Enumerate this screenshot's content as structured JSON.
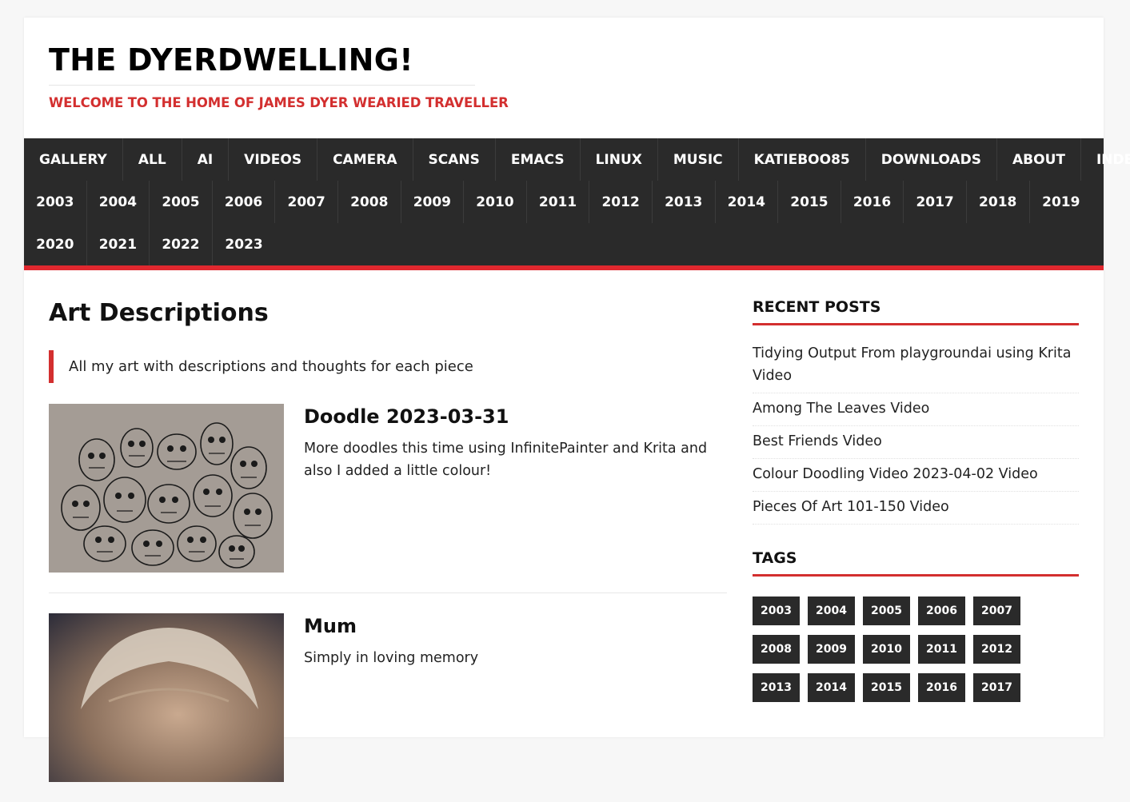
{
  "site": {
    "title": "THE DYERDWELLING!",
    "tagline": "WELCOME TO THE HOME OF JAMES DYER WEARIED TRAVELLER"
  },
  "nav": {
    "row1": [
      "GALLERY",
      "ALL",
      "AI",
      "VIDEOS",
      "CAMERA",
      "SCANS",
      "EMACS",
      "LINUX",
      "MUSIC",
      "KATIEBOO85",
      "DOWNLOADS",
      "ABOUT",
      "INDEX"
    ],
    "row2": [
      "2003",
      "2004",
      "2005",
      "2006",
      "2007",
      "2008",
      "2009",
      "2010",
      "2011",
      "2012",
      "2013",
      "2014",
      "2015",
      "2016",
      "2017",
      "2018",
      "2019"
    ],
    "row3": [
      "2020",
      "2021",
      "2022",
      "2023"
    ]
  },
  "main": {
    "heading": "Art Descriptions",
    "description": "All my art with descriptions and thoughts for each piece",
    "posts": [
      {
        "title": "Doodle 2023-03-31",
        "excerpt": "More doodles this time using InfinitePainter and Krita and also I added a little colour!"
      },
      {
        "title": "Mum",
        "excerpt": "Simply in loving memory"
      }
    ]
  },
  "sidebar": {
    "recent_title": "RECENT POSTS",
    "recent_posts": [
      "Tidying Output From playgroundai using Krita Video",
      "Among The Leaves Video",
      "Best Friends Video",
      "Colour Doodling Video 2023-04-02 Video",
      "Pieces Of Art 101-150 Video"
    ],
    "tags_title": "TAGS",
    "tags": [
      "2003",
      "2004",
      "2005",
      "2006",
      "2007",
      "2008",
      "2009",
      "2010",
      "2011",
      "2012",
      "2013",
      "2014",
      "2015",
      "2016",
      "2017"
    ]
  },
  "colors": {
    "accent": "#d32f2f",
    "nav_bg": "#2a2a2a"
  }
}
